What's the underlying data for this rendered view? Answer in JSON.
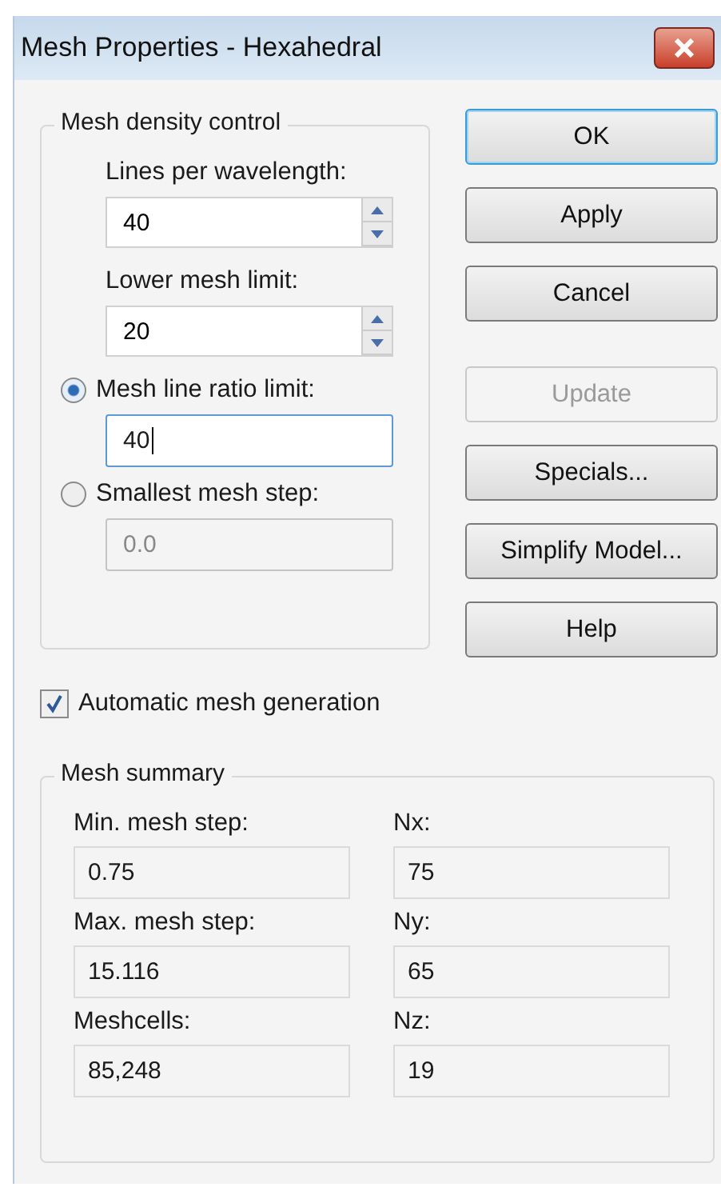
{
  "window": {
    "title": "Mesh Properties - Hexahedral"
  },
  "density_group": {
    "legend": "Mesh density control",
    "spinners": [
      {
        "label": "Lines per wavelength:",
        "value": "40"
      },
      {
        "label": "Lower mesh limit:",
        "value": "20"
      }
    ],
    "options": [
      {
        "label": "Mesh line ratio limit:",
        "selected": true,
        "value": "40",
        "focused": true
      },
      {
        "label": "Smallest mesh step:",
        "selected": false,
        "value": "0.0",
        "focused": false
      }
    ]
  },
  "buttons": [
    {
      "label": "OK",
      "default": true,
      "disabled": false
    },
    {
      "label": "Apply",
      "default": false,
      "disabled": false
    },
    {
      "label": "Cancel",
      "default": false,
      "disabled": false
    },
    {
      "label": "Update",
      "default": false,
      "disabled": true
    },
    {
      "label": "Specials...",
      "default": false,
      "disabled": false
    },
    {
      "label": "Simplify Model...",
      "default": false,
      "disabled": false
    },
    {
      "label": "Help",
      "default": false,
      "disabled": false
    }
  ],
  "automatic_mesh": {
    "label": "Automatic mesh generation",
    "checked": true
  },
  "summary": {
    "legend": "Mesh summary",
    "fields": [
      {
        "label": "Min. mesh step:",
        "value": "0.75"
      },
      {
        "label": "Nx:",
        "value": "75"
      },
      {
        "label": "Max. mesh step:",
        "value": "15.116"
      },
      {
        "label": "Ny:",
        "value": "65"
      },
      {
        "label": "Meshcells:",
        "value": "85,248"
      },
      {
        "label": "Nz:",
        "value": "19"
      }
    ]
  }
}
